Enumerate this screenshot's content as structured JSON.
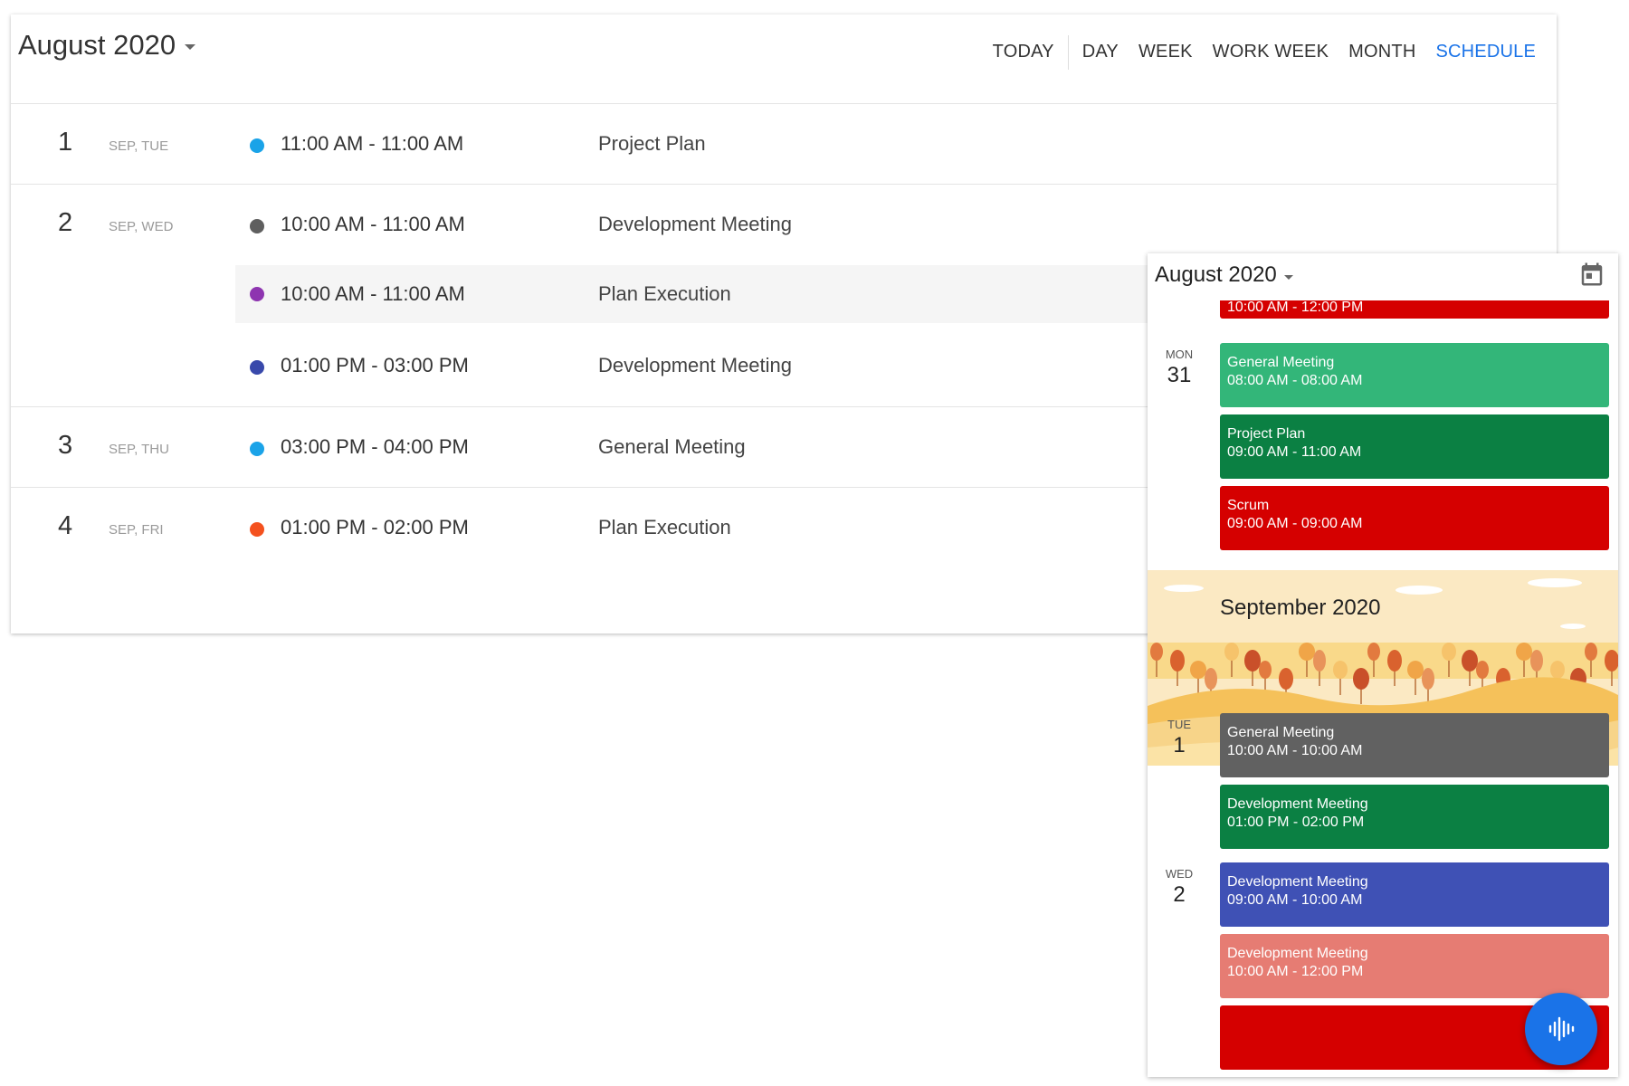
{
  "desktop": {
    "title": "August 2020",
    "views": [
      "TODAY",
      "DAY",
      "WEEK",
      "WORK WEEK",
      "MONTH",
      "SCHEDULE"
    ],
    "active_view": "SCHEDULE",
    "days": [
      {
        "date": "1",
        "label": "SEP, TUE",
        "events": [
          {
            "time": "11:00 AM - 11:00 AM",
            "subject": "Project Plan",
            "color": "#1aa3e8"
          }
        ]
      },
      {
        "date": "2",
        "label": "SEP, WED",
        "events": [
          {
            "time": "10:00 AM - 11:00 AM",
            "subject": "Development Meeting",
            "color": "#5f5f5f"
          },
          {
            "time": "10:00 AM - 11:00 AM",
            "subject": "Plan Execution",
            "color": "#8e35b0",
            "highlighted": true
          },
          {
            "time": "01:00 PM - 03:00 PM",
            "subject": "Development Meeting",
            "color": "#3949ab"
          }
        ]
      },
      {
        "date": "3",
        "label": "SEP, THU",
        "events": [
          {
            "time": "03:00 PM - 04:00 PM",
            "subject": "General Meeting",
            "color": "#1aa3e8"
          }
        ]
      },
      {
        "date": "4",
        "label": "SEP, FRI",
        "events": [
          {
            "time": "01:00 PM - 02:00 PM",
            "subject": "Plan Execution",
            "color": "#f4511e"
          }
        ]
      }
    ]
  },
  "mobile": {
    "title": "August 2020",
    "icon": "calendar-icon",
    "partial_event": {
      "time": "10:00 AM - 12:00 PM",
      "color": "#d50000"
    },
    "days_before_banner": [
      {
        "dow": "MON",
        "date": "31",
        "events": [
          {
            "subject": "General Meeting",
            "time": "08:00 AM - 08:00 AM",
            "color": "#33b679"
          },
          {
            "subject": "Project Plan",
            "time": "09:00 AM - 11:00 AM",
            "color": "#0b8043"
          },
          {
            "subject": "Scrum",
            "time": "09:00 AM - 09:00 AM",
            "color": "#d50000"
          }
        ]
      }
    ],
    "month_banner": "September 2020",
    "days_after_banner": [
      {
        "dow": "TUE",
        "date": "1",
        "events": [
          {
            "subject": "General Meeting",
            "time": "10:00 AM - 10:00 AM",
            "color": "#616161"
          },
          {
            "subject": "Development Meeting",
            "time": "01:00 PM - 02:00 PM",
            "color": "#0b8043"
          }
        ]
      },
      {
        "dow": "WED",
        "date": "2",
        "events": [
          {
            "subject": "Development Meeting",
            "time": "09:00 AM - 10:00 AM",
            "color": "#3f51b5"
          },
          {
            "subject": "Development Meeting",
            "time": "10:00 AM - 12:00 PM",
            "color": "#e67c73"
          }
        ]
      }
    ],
    "fab_icon": "voice-icon"
  }
}
